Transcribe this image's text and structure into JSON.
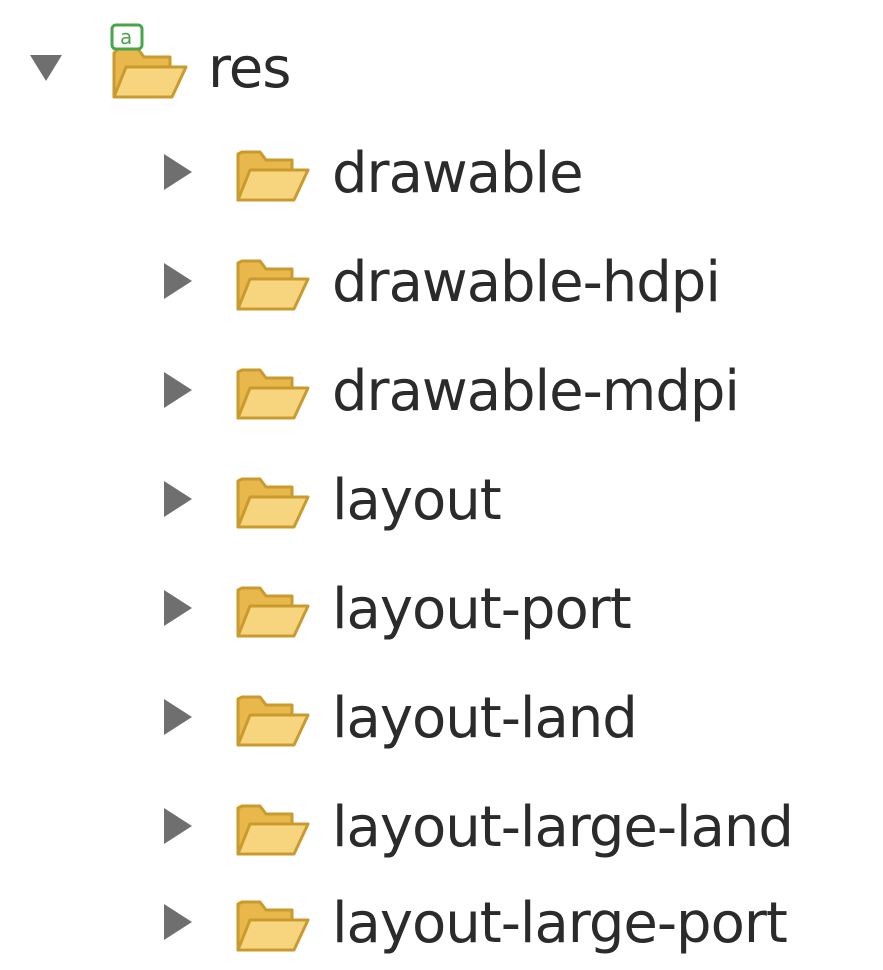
{
  "tree": {
    "root": {
      "label": "res",
      "expanded": true,
      "icon": "android-resource-folder-icon"
    },
    "children": [
      {
        "label": "drawable",
        "expanded": false,
        "icon": "folder-icon"
      },
      {
        "label": "drawable-hdpi",
        "expanded": false,
        "icon": "folder-icon"
      },
      {
        "label": "drawable-mdpi",
        "expanded": false,
        "icon": "folder-icon"
      },
      {
        "label": "layout",
        "expanded": false,
        "icon": "folder-icon"
      },
      {
        "label": "layout-port",
        "expanded": false,
        "icon": "folder-icon"
      },
      {
        "label": "layout-land",
        "expanded": false,
        "icon": "folder-icon"
      },
      {
        "label": "layout-large-land",
        "expanded": false,
        "icon": "folder-icon"
      },
      {
        "label": "layout-large-port",
        "expanded": false,
        "icon": "folder-icon"
      }
    ]
  },
  "colors": {
    "folder_fill": "#f4c96a",
    "folder_stroke": "#c99a2e",
    "twisty": "#6f6f6f",
    "android_badge": "#4aa54a",
    "text": "#2b2b2b"
  }
}
